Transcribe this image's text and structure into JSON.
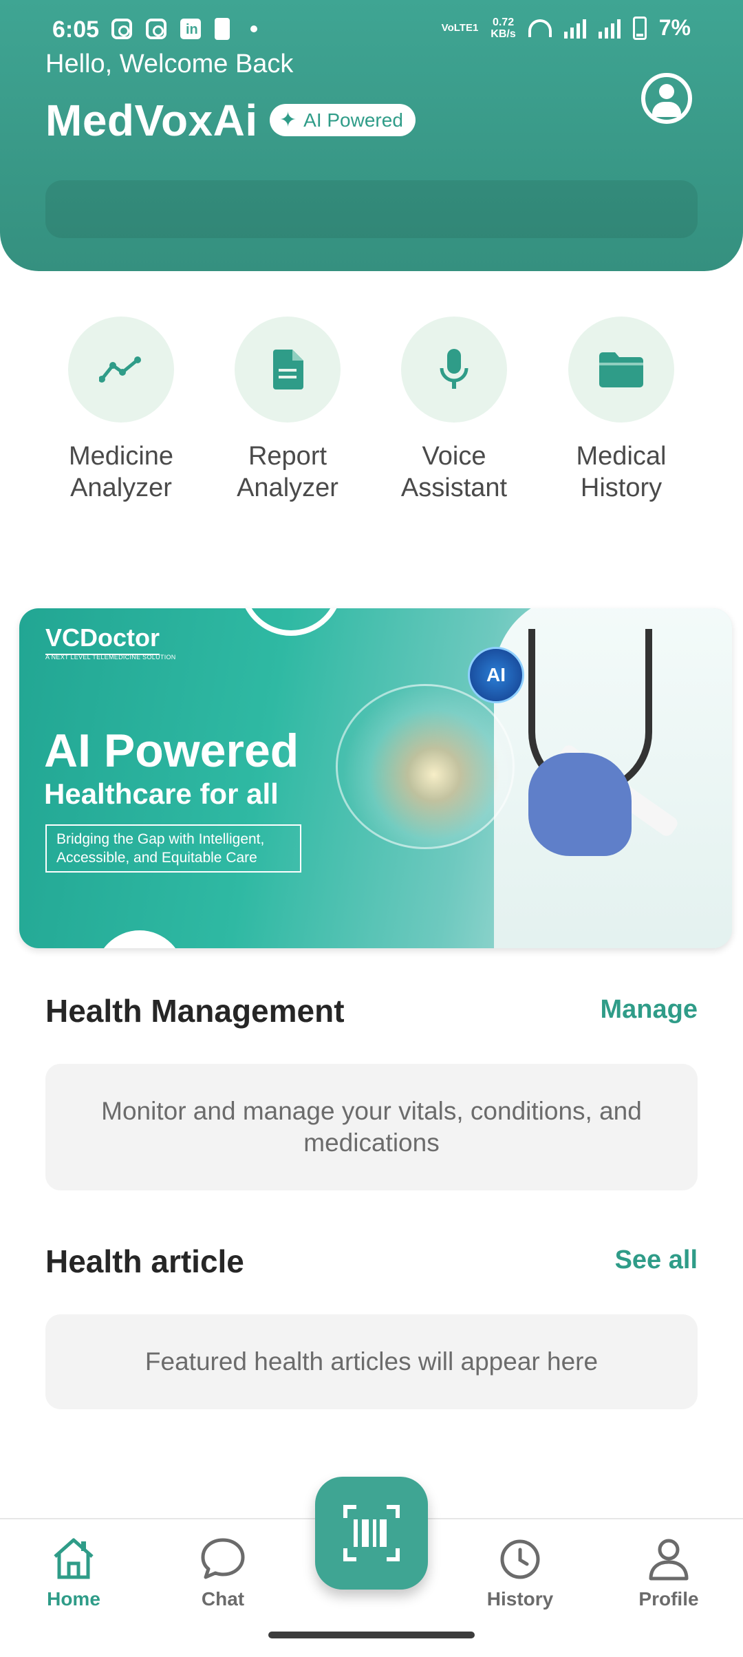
{
  "status_bar": {
    "time": "6:05",
    "network_type": "VoLTE1",
    "network_speed_value": "0.72",
    "network_speed_unit": "KB/s",
    "battery": "7%"
  },
  "header": {
    "greeting": "Hello, Welcome Back",
    "app_name": "MedVoxAi",
    "badge": "AI Powered",
    "accent_color": "#3fa593"
  },
  "quick_actions": [
    {
      "label_line1": "Medicine",
      "label_line2": "Analyzer",
      "icon": "chart-line-icon"
    },
    {
      "label_line1": "Report",
      "label_line2": "Analyzer",
      "icon": "document-icon"
    },
    {
      "label_line1": "Voice",
      "label_line2": "Assistant",
      "icon": "microphone-icon"
    },
    {
      "label_line1": "Medical",
      "label_line2": "History",
      "icon": "folder-icon"
    }
  ],
  "banner": {
    "brand": "VCDoctor",
    "brand_sub": "A NEXT LEVEL TELEMEDICINE SOLUTION",
    "headline": "AI Powered",
    "subheadline": "Healthcare for all",
    "tagline_line1": "Bridging the Gap with Intelligent,",
    "tagline_line2": "Accessible, and Equitable Care",
    "globe_text": "AI"
  },
  "health_management": {
    "title": "Health Management",
    "link": "Manage",
    "description": "Monitor and manage your vitals, conditions, and medications"
  },
  "health_article": {
    "title": "Health article",
    "link": "See all",
    "placeholder": "Featured health articles will appear here"
  },
  "bottom_nav": {
    "items": [
      {
        "label": "Home",
        "icon": "home-icon",
        "active": true
      },
      {
        "label": "Chat",
        "icon": "chat-bubble-icon",
        "active": false
      },
      {
        "label": "History",
        "icon": "clock-icon",
        "active": false
      },
      {
        "label": "Profile",
        "icon": "person-icon",
        "active": false
      }
    ],
    "scan_icon": "barcode-scan-icon"
  }
}
